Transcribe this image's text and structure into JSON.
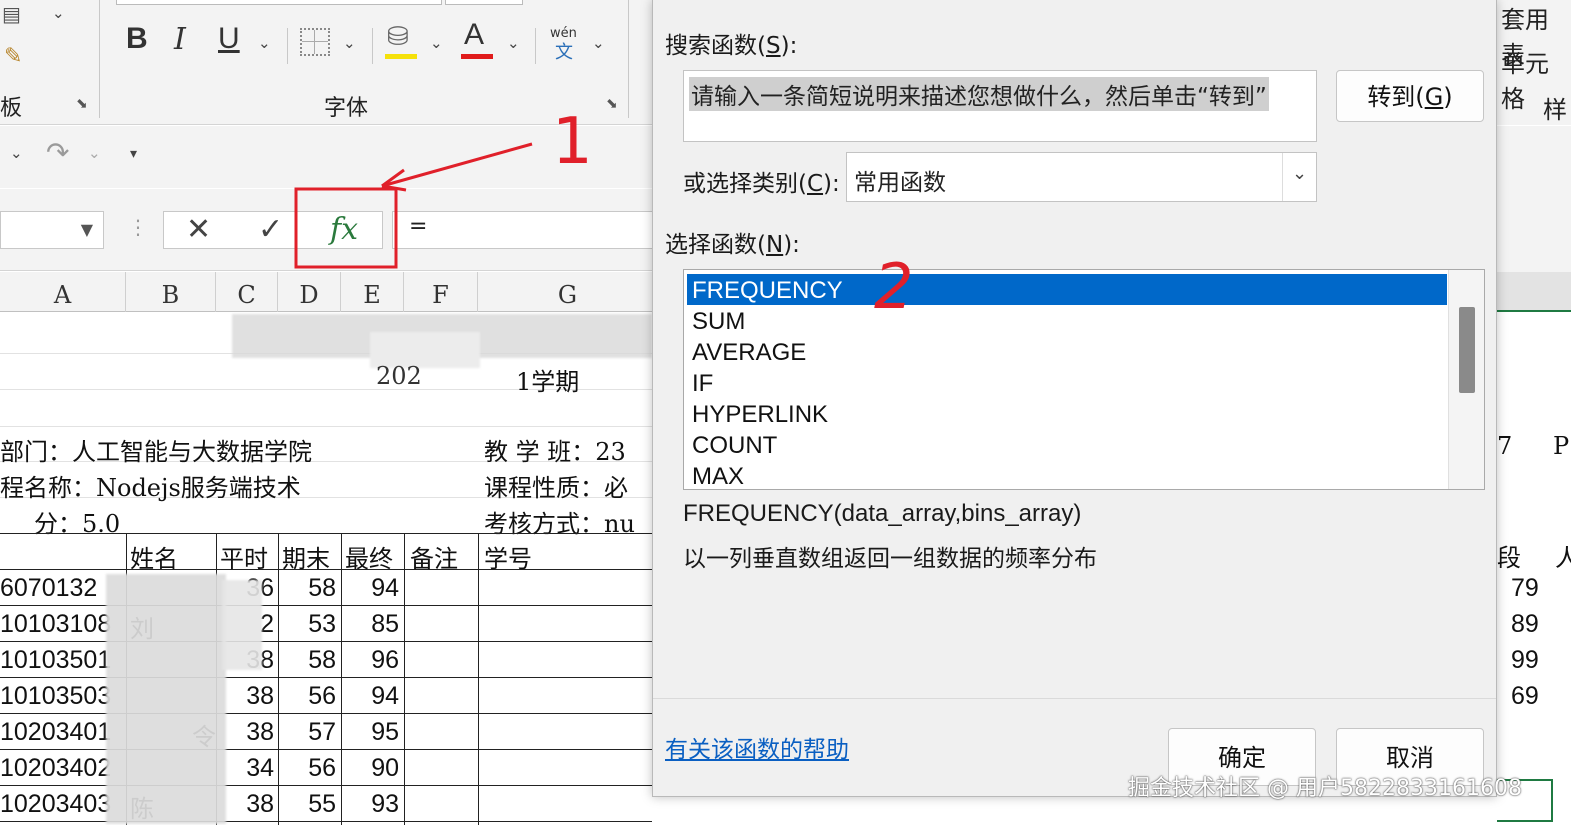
{
  "ribbon": {
    "clipboard_group_label": "板",
    "bold_label": "B",
    "italic_label": "I",
    "underline_label": "U",
    "font_color_label": "A",
    "phonetic_top": "wén",
    "phonetic_bottom": "文",
    "font_group_label": "字体",
    "highlight_color": "#f5e10a",
    "font_color": "#e01b1b"
  },
  "formula_bar": {
    "cancel_icon": "✕",
    "enter_icon": "✓",
    "fx_label": "fx",
    "content": "="
  },
  "columns": [
    "A",
    "B",
    "C",
    "D",
    "E",
    "F",
    "G"
  ],
  "sheet": {
    "semester_fragment": "1学期",
    "semester_prefix": "202",
    "info": {
      "dept": "部门：人工智能与大数据学院",
      "course": "程名称：Nodejs服务端技术",
      "credit": "分：5.0",
      "class": "教 学 班：23",
      "nature": "课程性质：必",
      "exam": "考核方式：nu"
    },
    "header": {
      "name": "姓名",
      "regular": "平时",
      "final": "期末",
      "total": "最终",
      "remark": "备注",
      "student_no": "学号"
    },
    "rows": [
      {
        "id": "6070132",
        "regular": "36",
        "final": "58",
        "total": "94",
        "name": "",
        "right": "79"
      },
      {
        "id": "10103108",
        "regular": "2",
        "final": "53",
        "total": "85",
        "name": "刘",
        "right": "89"
      },
      {
        "id": "10103501",
        "regular": "38",
        "final": "58",
        "total": "96",
        "name": "",
        "right": "99"
      },
      {
        "id": "10103503",
        "regular": "38",
        "final": "56",
        "total": "94",
        "name": "",
        "right": "69"
      },
      {
        "id": "10203401",
        "regular": "38",
        "final": "57",
        "total": "95",
        "name": "令",
        "right": ""
      },
      {
        "id": "10203402",
        "regular": "34",
        "final": "56",
        "total": "90",
        "name": "",
        "right": ""
      },
      {
        "id": "10203403",
        "regular": "38",
        "final": "55",
        "total": "93",
        "name": "陈",
        "right": ""
      }
    ]
  },
  "right_strip": {
    "format_table": "套用表",
    "cell_format": "单元格",
    "style": "样",
    "cell_7": "7",
    "cell_p": "P",
    "cell_grade": "段",
    "cell_person": "人"
  },
  "dialog": {
    "search_label": "搜索函数(",
    "search_key": "S",
    "search_label_end": "):",
    "search_value": "请输入一条简短说明来描述您想做什么，然后单击“转到”",
    "goto_label": "转到(",
    "goto_key": "G",
    "goto_end": ")",
    "category_label": "或选择类别(",
    "category_key": "C",
    "category_end": "):",
    "category_value": "常用函数",
    "function_label": "选择函数(",
    "function_key": "N",
    "function_end": "):",
    "functions": [
      "FREQUENCY",
      "SUM",
      "AVERAGE",
      "IF",
      "HYPERLINK",
      "COUNT",
      "MAX"
    ],
    "selected_index": 0,
    "syntax": "FREQUENCY(data_array,bins_array)",
    "description": "以一列垂直数组返回一组数据的频率分布",
    "help_link": "有关该函数的帮助",
    "ok_label": "确定",
    "cancel_label": "取消"
  },
  "annotations": {
    "mark_1": "1",
    "mark_2": "2",
    "color": "#e0202a"
  },
  "watermark": "掘金技术社区 @ 用户5822833161608"
}
